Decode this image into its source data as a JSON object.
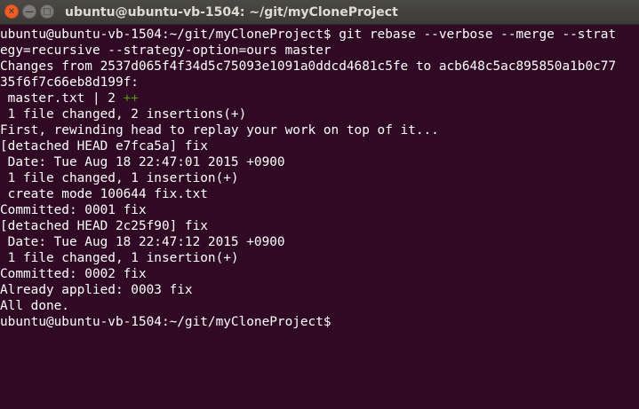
{
  "window": {
    "title": "ubuntu@ubuntu-vb-1504: ~/git/myCloneProject",
    "close_glyph": "✕",
    "minimize_glyph": "—",
    "maximize_glyph": "□"
  },
  "colors": {
    "terminal_background": "#300a24",
    "terminal_text": "#ffffff",
    "diffstat_plus": "#4e9a06",
    "close_button": "#f15d22"
  },
  "terminal": {
    "lines": [
      "ubuntu@ubuntu-vb-1504:~/git/myCloneProject$ git rebase --verbose --merge --strat",
      "egy=recursive --strategy-option=ours master",
      "Changes from 2537d065f4f34d5c75093e1091a0ddcd4681c5fe to acb648c5ac895850a1b0c77",
      "35f6f7c66eb8d199f:",
      " master.txt | 2 ",
      " 1 file changed, 2 insertions(+)",
      "First, rewinding head to replay your work on top of it...",
      "[detached HEAD e7fca5a] fix",
      " Date: Tue Aug 18 22:47:01 2015 +0900",
      " 1 file changed, 1 insertion(+)",
      " create mode 100644 fix.txt",
      "Committed: 0001 fix",
      "[detached HEAD 2c25f90] fix",
      " Date: Tue Aug 18 22:47:12 2015 +0900",
      " 1 file changed, 1 insertion(+)",
      "Committed: 0002 fix",
      "Already applied: 0003 fix",
      "All done.",
      "ubuntu@ubuntu-vb-1504:~/git/myCloneProject$ "
    ],
    "diffstat_plus": "++"
  }
}
